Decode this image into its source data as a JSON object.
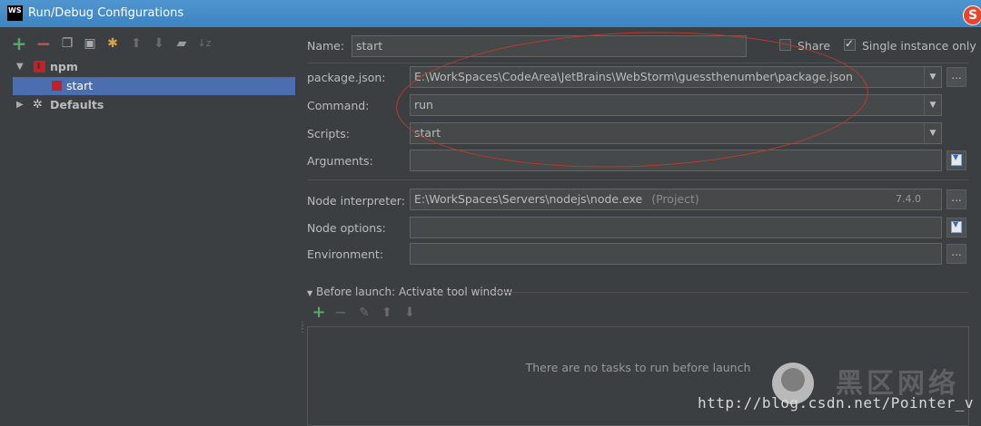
{
  "window": {
    "app_logo": "WS",
    "title": "Run/Debug Configurations"
  },
  "left_toolbar": {
    "icons": [
      "add-icon",
      "remove-icon",
      "copy-icon",
      "save-icon",
      "edit-defaults-icon",
      "move-up-icon",
      "move-down-icon",
      "folder-icon",
      "sort-icon"
    ]
  },
  "tree": {
    "npm_label": "npm",
    "start_label": "start",
    "defaults_label": "Defaults"
  },
  "form": {
    "name_label": "Name:",
    "name_value": "start",
    "share_label": "Share",
    "share_checked": false,
    "single_instance_label": "Single instance only",
    "single_instance_checked": true,
    "package_json_label": "package.json:",
    "package_json_value": "E:\\WorkSpaces\\CodeArea\\JetBrains\\WebStorm\\guessthenumber\\package.json",
    "command_label": "Command:",
    "command_value": "run",
    "scripts_label": "Scripts:",
    "scripts_value": "start",
    "arguments_label": "Arguments:",
    "arguments_value": "",
    "node_interpreter_label": "Node interpreter:",
    "node_interpreter_value": "E:\\WorkSpaces\\Servers\\nodejs\\node.exe",
    "node_interpreter_hint": "(Project)",
    "node_version": "7.4.0",
    "node_options_label": "Node options:",
    "node_options_value": "",
    "environment_label": "Environment:",
    "environment_value": "",
    "browse_label": "..."
  },
  "before_launch": {
    "title": "Before launch: Activate tool window",
    "empty_text": "There are no tasks to run before launch"
  },
  "watermark": {
    "url": "http://blog.csdn.net/Pointer_v",
    "cn_text": "黑区网络"
  },
  "colors": {
    "background": "#3c3f41",
    "titlebar": "#3c83c2",
    "selection": "#4b6eaf",
    "annotation_ellipse": "#c0392b",
    "add_green": "#59a869",
    "remove_red": "#c75450"
  }
}
